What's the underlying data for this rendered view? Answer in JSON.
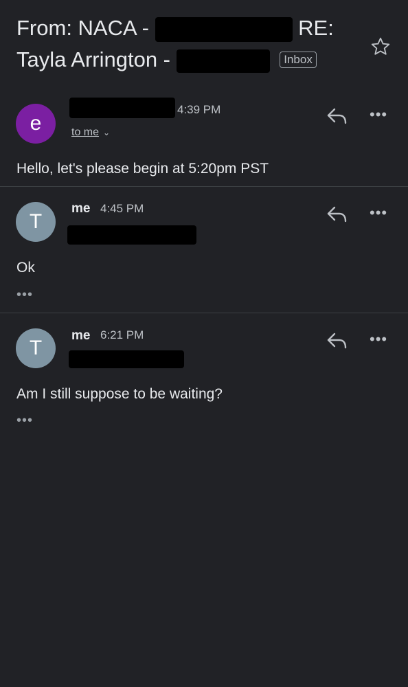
{
  "thread": {
    "subject_line1_prefix": "From: NACA -",
    "subject_line1_suffix": "RE:",
    "subject_line2_prefix": "Tayla Arrington -",
    "label": "Inbox"
  },
  "messages": [
    {
      "avatar_letter": "e",
      "avatar_color": "#7b1fa2",
      "sender": "",
      "time": "4:39 PM",
      "recipient": "to me",
      "body": "Hello, let's please begin at 5:20pm PST",
      "collapsed_indicator": ""
    },
    {
      "avatar_letter": "T",
      "avatar_color": "#7f95a3",
      "sender": "me",
      "time": "4:45 PM",
      "recipient": "",
      "body": "Ok",
      "collapsed_indicator": "•••"
    },
    {
      "avatar_letter": "T",
      "avatar_color": "#7f95a3",
      "sender": "me",
      "time": "6:21 PM",
      "recipient": "",
      "body": "Am I still suppose to be waiting?",
      "collapsed_indicator": "•••"
    }
  ],
  "icons": {
    "star": "star-outline-icon",
    "reply": "reply-icon",
    "more": "more-horizontal-icon"
  },
  "colors": {
    "background": "#212226",
    "text": "#e8eaed",
    "muted": "#bdc1c6"
  }
}
